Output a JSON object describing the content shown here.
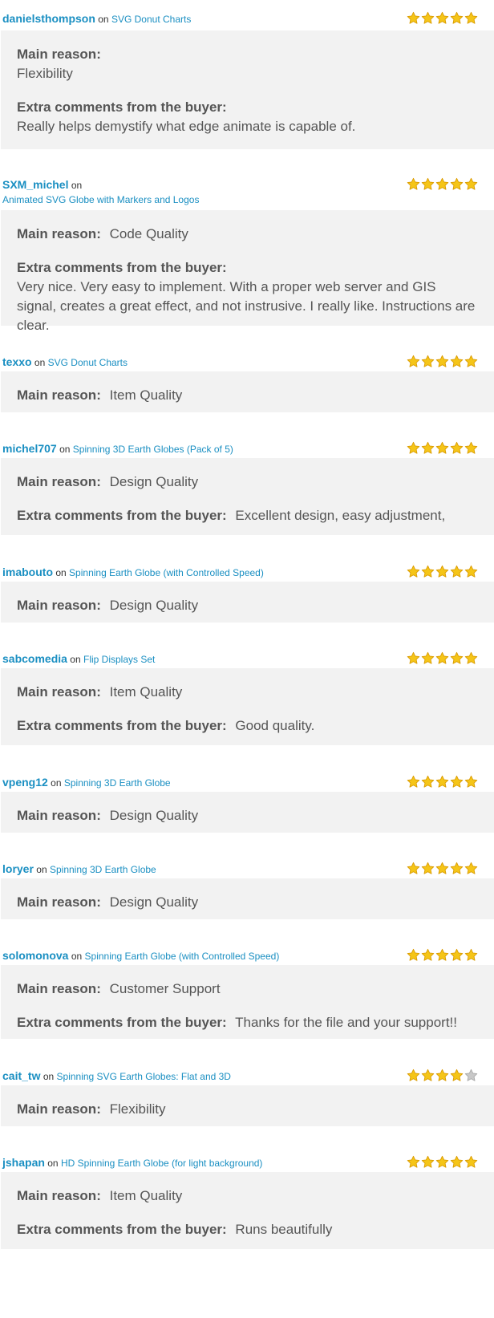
{
  "labels": {
    "on": "on",
    "main_reason": "Main reason:",
    "extra_comments": "Extra comments from the buyer:"
  },
  "colors": {
    "link": "#1a8fc2",
    "star_filled": "#f5c518",
    "star_empty": "#c8c8c8",
    "body_bg": "#f2f2f2"
  },
  "reviews": [
    {
      "user": "danielsthompson",
      "item": "SVG Donut Charts",
      "rating": 5,
      "reason": "Flexibility",
      "comment": "Really helps demystify what edge animate is capable of."
    },
    {
      "user": "SXM_michel",
      "item": "Animated SVG Globe with Markers and Logos",
      "rating": 5,
      "reason": "Code Quality",
      "comment": "Very nice. Very easy to implement. With a proper web server and GIS signal, creates a great effect, and not instrusive. I really like. Instructions are clear."
    },
    {
      "user": "texxo",
      "item": "SVG Donut Charts",
      "rating": 5,
      "reason": "Item Quality",
      "comment": ""
    },
    {
      "user": "michel707",
      "item": "Spinning 3D Earth Globes (Pack of 5)",
      "rating": 5,
      "reason": "Design Quality",
      "comment": "Excellent design, easy adjustment,"
    },
    {
      "user": "imabouto",
      "item": "Spinning Earth Globe (with Controlled Speed)",
      "rating": 5,
      "reason": "Design Quality",
      "comment": ""
    },
    {
      "user": "sabcomedia",
      "item": "Flip Displays Set",
      "rating": 5,
      "reason": "Item Quality",
      "comment": "Good quality."
    },
    {
      "user": "vpeng12",
      "item": "Spinning 3D Earth Globe",
      "rating": 5,
      "reason": "Design Quality",
      "comment": ""
    },
    {
      "user": "loryer",
      "item": "Spinning 3D Earth Globe",
      "rating": 5,
      "reason": "Design Quality",
      "comment": ""
    },
    {
      "user": "solomonova",
      "item": "Spinning Earth Globe (with Controlled Speed)",
      "rating": 5,
      "reason": "Customer Support",
      "comment": "Thanks for the file and your support!!"
    },
    {
      "user": "cait_tw",
      "item": "Spinning SVG Earth Globes: Flat and 3D",
      "rating": 4,
      "reason": "Flexibility",
      "comment": ""
    },
    {
      "user": "jshapan",
      "item": "HD Spinning Earth Globe (for light background)",
      "rating": 5,
      "reason": "Item Quality",
      "comment": "Runs beautifully"
    }
  ]
}
